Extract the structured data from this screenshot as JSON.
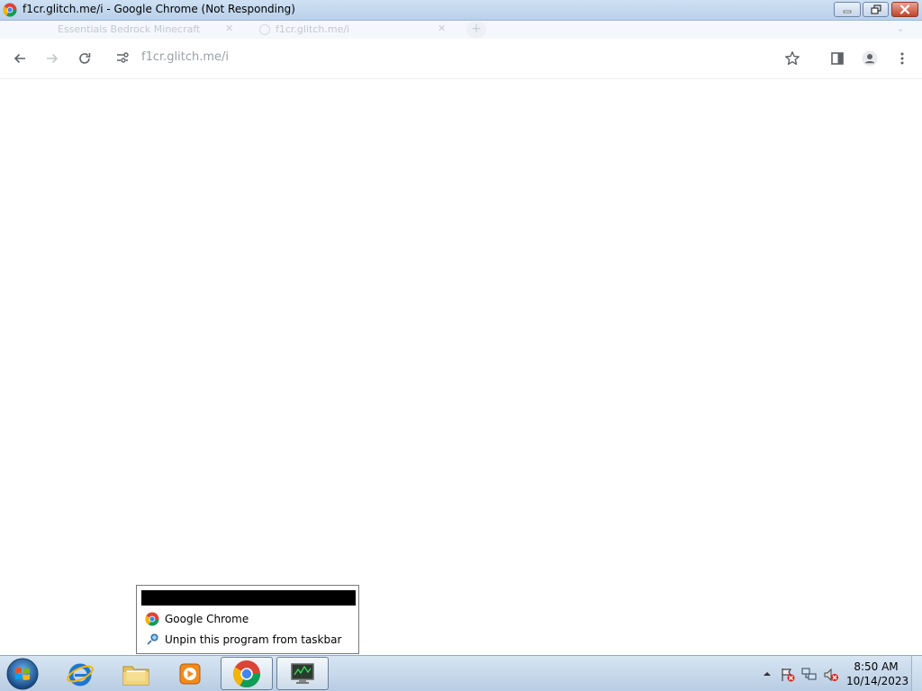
{
  "window": {
    "title": "f1cr.glitch.me/i - Google Chrome (Not Responding)",
    "icon": "chrome-icon"
  },
  "tabs": [
    {
      "label": "Essentials Bedrock Minecraft",
      "close": "✕"
    },
    {
      "label": "f1cr.glitch.me/i",
      "close": "✕"
    }
  ],
  "toolbar": {
    "back_icon": "arrow-left-icon",
    "forward_icon": "arrow-right-icon",
    "reload_icon": "reload-icon",
    "url": "f1cr.glitch.me/i",
    "bookmark_icon": "star-icon",
    "side_panel_icon": "side-panel-icon",
    "profile_icon": "profile-icon",
    "menu_icon": "kebab-menu-icon"
  },
  "jumplist": {
    "items": [
      {
        "label": "Google Chrome",
        "icon": "chrome-icon"
      },
      {
        "label": "Unpin this program from taskbar",
        "icon": "unpin-icon"
      }
    ]
  },
  "taskbar": {
    "apps": [
      {
        "name": "Internet Explorer",
        "icon": "ie-icon"
      },
      {
        "name": "Windows Explorer",
        "icon": "folder-icon"
      },
      {
        "name": "Windows Media Player",
        "icon": "media-player-icon"
      },
      {
        "name": "Google Chrome",
        "icon": "chrome-icon",
        "active": true
      },
      {
        "name": "Task Manager",
        "icon": "monitor-icon"
      }
    ],
    "clock_time": "8:50 AM",
    "clock_date": "10/14/2023"
  },
  "colors": {
    "titlebar": "#b9d1ea",
    "taskbar": "#c8dbef",
    "chrome_red": "#db4437",
    "chrome_yellow": "#f4b400",
    "chrome_green": "#0f9d58",
    "chrome_blue": "#4285f4"
  }
}
